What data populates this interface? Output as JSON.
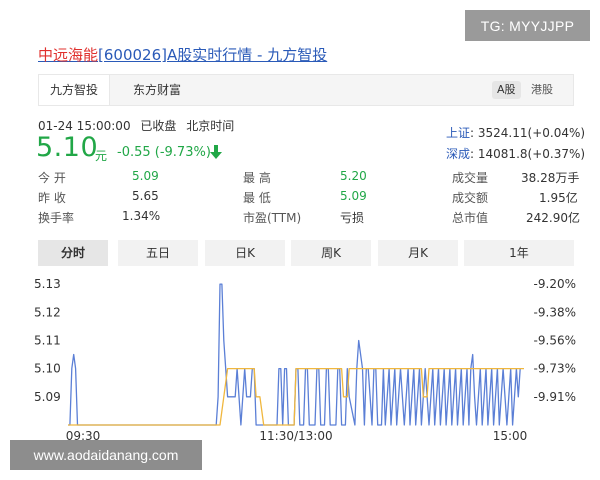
{
  "watermark_top": "TG: MYYJJPP",
  "watermark_bottom": "www.aodaidanang.com",
  "title": {
    "name": "中远海能",
    "code": "[600026]",
    "suffix": "A股实时行情 - 九方智投"
  },
  "source_tabs": [
    "九方智投",
    "东方财富"
  ],
  "market_tabs": [
    "A股",
    "港股"
  ],
  "quote": {
    "timestamp": "01-24 15:00:00",
    "status": "已收盘",
    "timezone": "北京时间",
    "price": "5.10",
    "unit": "元",
    "change": "-0.55 (-9.73%)",
    "trend": "down",
    "color_down": "#21a747",
    "link_color": "#2a5ab8"
  },
  "indices": [
    {
      "name": "上证",
      "value": "3524.11(+0.04%)"
    },
    {
      "name": "深成",
      "value": "14081.8(+0.37%)"
    }
  ],
  "stats": {
    "open_label": "今    开",
    "open_value": "5.09",
    "prev_label": "昨    收",
    "prev_value": "5.65",
    "turnover_label": "换手率",
    "turnover_value": "1.34%",
    "high_label": "最    高",
    "high_value": "5.20",
    "low_label": "最    低",
    "low_value": "5.09",
    "pe_label": "市盈(TTM)",
    "pe_value": "亏损",
    "vol_label": "成交量",
    "vol_value": "38.28万手",
    "amt_label": "成交额",
    "amt_value": "1.95亿",
    "mcap_label": "总市值",
    "mcap_value": "242.90亿"
  },
  "period_tabs": [
    "分时",
    "五日",
    "日K",
    "周K",
    "月K",
    "1年"
  ],
  "chart_data": {
    "type": "line",
    "x_ticks": [
      "09:30",
      "11:30/13:00",
      "15:00"
    ],
    "y_left_ticks": [
      "5.13",
      "5.12",
      "5.11",
      "5.10",
      "5.09"
    ],
    "y_right_ticks": [
      "-9.20%",
      "-9.38%",
      "-9.56%",
      "-9.73%",
      "-9.91%"
    ],
    "ylim": [
      5.08,
      5.135
    ],
    "xlim": [
      0,
      240
    ],
    "grid": false,
    "series": [
      {
        "color": "#5b7fd6",
        "points": [
          [
            0,
            5.08
          ],
          [
            1,
            5.08
          ],
          [
            2,
            5.1
          ],
          [
            3,
            5.105
          ],
          [
            4,
            5.1
          ],
          [
            5,
            5.08
          ],
          [
            6,
            5.08
          ],
          [
            78,
            5.08
          ],
          [
            79,
            5.09
          ],
          [
            80,
            5.13
          ],
          [
            81,
            5.13
          ],
          [
            82,
            5.11
          ],
          [
            83,
            5.1
          ],
          [
            84,
            5.09
          ],
          [
            88,
            5.09
          ],
          [
            89,
            5.1
          ],
          [
            90,
            5.09
          ],
          [
            91,
            5.08
          ],
          [
            92,
            5.09
          ],
          [
            93,
            5.1
          ],
          [
            94,
            5.09
          ],
          [
            96,
            5.09
          ],
          [
            97,
            5.1
          ],
          [
            98,
            5.1
          ],
          [
            99,
            5.08
          ],
          [
            110,
            5.08
          ],
          [
            111,
            5.1
          ],
          [
            112,
            5.1
          ],
          [
            113,
            5.08
          ],
          [
            114,
            5.1
          ],
          [
            115,
            5.1
          ],
          [
            116,
            5.08
          ],
          [
            119,
            5.08
          ],
          [
            120,
            5.1
          ],
          [
            121,
            5.1
          ],
          [
            122,
            5.08
          ],
          [
            124,
            5.08
          ],
          [
            125,
            5.1
          ],
          [
            126,
            5.1
          ],
          [
            127,
            5.08
          ],
          [
            130,
            5.08
          ],
          [
            131,
            5.1
          ],
          [
            132,
            5.1
          ],
          [
            133,
            5.08
          ],
          [
            135,
            5.08
          ],
          [
            136,
            5.1
          ],
          [
            137,
            5.1
          ],
          [
            138,
            5.08
          ],
          [
            141,
            5.08
          ],
          [
            142,
            5.1
          ],
          [
            143,
            5.1
          ],
          [
            144,
            5.08
          ],
          [
            146,
            5.08
          ],
          [
            147,
            5.1
          ],
          [
            148,
            5.09
          ],
          [
            151,
            5.08
          ],
          [
            152,
            5.1
          ],
          [
            153,
            5.11
          ],
          [
            154,
            5.105
          ],
          [
            155,
            5.1
          ],
          [
            156,
            5.08
          ],
          [
            157,
            5.1
          ],
          [
            158,
            5.1
          ],
          [
            160,
            5.08
          ],
          [
            161,
            5.1
          ],
          [
            162,
            5.1
          ],
          [
            163,
            5.08
          ],
          [
            165,
            5.08
          ],
          [
            166,
            5.1
          ],
          [
            167,
            5.08
          ],
          [
            169,
            5.1
          ],
          [
            170,
            5.08
          ],
          [
            172,
            5.1
          ],
          [
            173,
            5.08
          ],
          [
            175,
            5.1
          ],
          [
            176,
            5.09
          ],
          [
            177,
            5.08
          ],
          [
            179,
            5.1
          ],
          [
            180,
            5.08
          ],
          [
            182,
            5.1
          ],
          [
            183,
            5.08
          ],
          [
            185,
            5.1
          ],
          [
            186,
            5.08
          ],
          [
            188,
            5.1
          ],
          [
            189,
            5.09
          ],
          [
            190,
            5.08
          ],
          [
            192,
            5.1
          ],
          [
            193,
            5.08
          ],
          [
            195,
            5.1
          ],
          [
            196,
            5.08
          ],
          [
            198,
            5.1
          ],
          [
            199,
            5.08
          ],
          [
            201,
            5.1
          ],
          [
            202,
            5.08
          ],
          [
            204,
            5.1
          ],
          [
            205,
            5.08
          ],
          [
            207,
            5.1
          ],
          [
            208,
            5.08
          ],
          [
            210,
            5.1
          ],
          [
            211,
            5.08
          ],
          [
            212,
            5.1
          ],
          [
            213,
            5.105
          ],
          [
            214,
            5.09
          ],
          [
            215,
            5.08
          ],
          [
            217,
            5.1
          ],
          [
            218,
            5.08
          ],
          [
            220,
            5.1
          ],
          [
            221,
            5.08
          ],
          [
            223,
            5.1
          ],
          [
            224,
            5.08
          ],
          [
            226,
            5.1
          ],
          [
            227,
            5.08
          ],
          [
            229,
            5.1
          ],
          [
            230,
            5.09
          ],
          [
            231,
            5.08
          ],
          [
            233,
            5.1
          ],
          [
            234,
            5.08
          ],
          [
            236,
            5.1
          ],
          [
            237,
            5.09
          ],
          [
            238,
            5.1
          ]
        ]
      },
      {
        "color": "#f0b73e",
        "points": [
          [
            0,
            5.08
          ],
          [
            78,
            5.08
          ],
          [
            80,
            5.08
          ],
          [
            82,
            5.09
          ],
          [
            84,
            5.1
          ],
          [
            90,
            5.1
          ],
          [
            95,
            5.1
          ],
          [
            98,
            5.1
          ],
          [
            99,
            5.09
          ],
          [
            101,
            5.09
          ],
          [
            103,
            5.08
          ],
          [
            119,
            5.08
          ],
          [
            120,
            5.1
          ],
          [
            123,
            5.1
          ],
          [
            140,
            5.1
          ],
          [
            144,
            5.1
          ],
          [
            145,
            5.09
          ],
          [
            147,
            5.09
          ],
          [
            148,
            5.1
          ],
          [
            180,
            5.1
          ],
          [
            182,
            5.1
          ],
          [
            186,
            5.1
          ],
          [
            187,
            5.09
          ],
          [
            189,
            5.09
          ],
          [
            190,
            5.1
          ],
          [
            200,
            5.1
          ],
          [
            240,
            5.1
          ]
        ]
      }
    ]
  }
}
